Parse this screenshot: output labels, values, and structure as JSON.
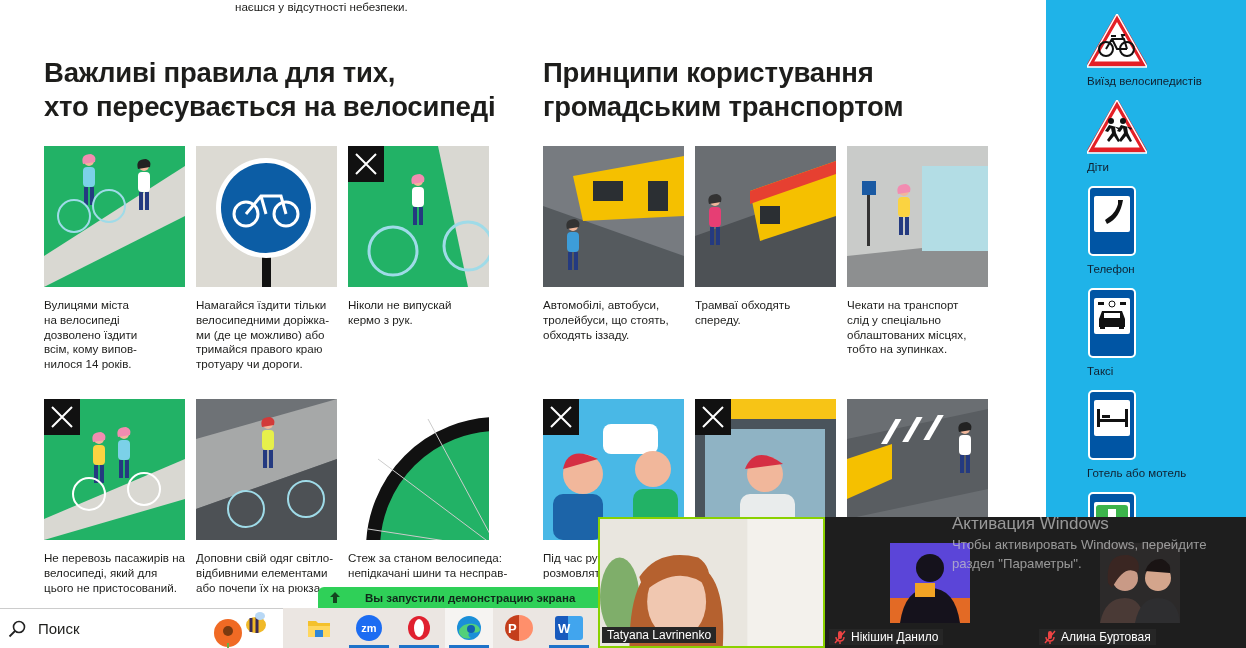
{
  "top_text": "наєшся у відсутності небезпеки.",
  "sections": [
    {
      "title_lines": [
        "Важливі правила для тих,",
        "хто пересувається на велосипеді"
      ],
      "cards": [
        {
          "crossed": false,
          "lines": [
            "Вулицями міста",
            "на велосипеді",
            "дозволено їздити",
            "всім, кому випов-",
            "нилося 14 років."
          ]
        },
        {
          "crossed": false,
          "lines": [
            "Намагайся їздити тільки",
            "велосипедними доріжка-",
            "ми (де це можливо) або",
            "тримайся правого краю",
            "тротуару чи дороги."
          ]
        },
        {
          "crossed": true,
          "lines": [
            "Ніколи не випускай",
            "кермо з рук."
          ]
        },
        {
          "crossed": true,
          "lines": [
            "Не перевозь пасажирів на",
            "велосипеді, який для",
            "цього не пристосований."
          ]
        },
        {
          "crossed": false,
          "lines": [
            "Доповни свій одяг світло-",
            "відбивними елементами",
            "або почепи їх на рюкза"
          ]
        },
        {
          "crossed": false,
          "lines": [
            "Стеж за станом велосипеда:",
            "непідкачані шини та несправ-"
          ]
        }
      ]
    },
    {
      "title_lines": [
        "Принципи користування",
        "громадським транспортом"
      ],
      "cards": [
        {
          "crossed": false,
          "lines": [
            "Автомобілі, автобуси,",
            "тролейбуси, що стоять,",
            "обходять іззаду."
          ]
        },
        {
          "crossed": false,
          "lines": [
            "Трамваї обходять",
            "спереду."
          ]
        },
        {
          "crossed": false,
          "lines": [
            "Чекати на транспорт",
            "слід у спеціально",
            "облаштованих місцях,",
            "тобто на зупинках."
          ]
        },
        {
          "crossed": true,
          "lines": [
            "Під час ру",
            "розмовлят"
          ]
        },
        {
          "crossed": true
        },
        {
          "crossed": false
        }
      ]
    }
  ],
  "sidebar": {
    "signs": [
      {
        "kind": "bicycle",
        "label": "Виїзд велосипедистів"
      },
      {
        "kind": "children",
        "label": "Діти"
      },
      {
        "kind": "phone",
        "label": "Телефон"
      },
      {
        "kind": "taxi",
        "label": "Таксі"
      },
      {
        "kind": "bed",
        "label": "Готель або мотель"
      },
      {
        "kind": "first-aid"
      }
    ]
  },
  "banner": {
    "text": "Вы запустили демонстрацию экрана"
  },
  "taskbar": {
    "search_placeholder": "Поиск",
    "apps": [
      {
        "kind": "folder",
        "running": false,
        "active": false
      },
      {
        "kind": "zm",
        "glyph": "zm",
        "running": true,
        "active": false
      },
      {
        "kind": "opera",
        "running": true,
        "active": false
      },
      {
        "kind": "edge",
        "running": true,
        "active": true
      },
      {
        "kind": "slides",
        "glyph": "P",
        "running": false,
        "active": false
      },
      {
        "kind": "document",
        "glyph": "W",
        "running": true,
        "active": false
      }
    ]
  },
  "meeting": {
    "participants": [
      {
        "name": "Tatyana Lavrinenko",
        "kind": "video",
        "speaking": true,
        "muted": false
      },
      {
        "name": "Нікішин Данило",
        "kind": "avatar",
        "speaking": false,
        "muted": true
      },
      {
        "name": "Алина Буртовая",
        "kind": "couple",
        "speaking": false,
        "muted": true
      }
    ]
  },
  "activation_notice": {
    "title": "Активация Windows",
    "lines": [
      "Чтобы активировать Windows, перейдите",
      "раздел \"Параметры\"."
    ]
  }
}
